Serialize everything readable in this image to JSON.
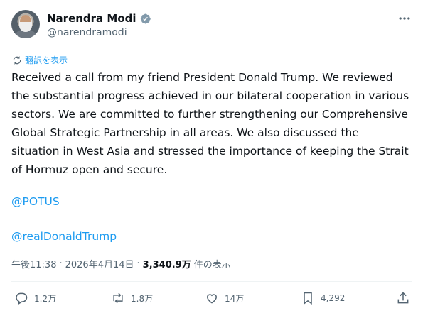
{
  "author": {
    "name": "Narendra Modi",
    "handle": "@narendramodi",
    "verified_color": "#829aab"
  },
  "translate_label": "翻訳を表示",
  "tweet": {
    "text": "Received a call from my friend President Donald Trump. We reviewed the substantial progress achieved in our bilateral cooperation in various sectors. We are committed to further strengthening our Comprehensive Global Strategic Partnership in all areas. We also discussed the situation in West Asia and stressed the importance of keeping the Strait of Hormuz open and secure.",
    "mentions": [
      "@POTUS",
      "@realDonaldTrump"
    ]
  },
  "meta": {
    "time": "午後11:38",
    "separator": "·",
    "date": "2026年4月14日",
    "views": "3,340.9万",
    "views_suffix": "件の表示"
  },
  "actions": {
    "reply": "1.2万",
    "retweet": "1.8万",
    "like": "14万",
    "bookmark": "4,292"
  },
  "colors": {
    "accent": "#1d9bf0",
    "muted": "#536471",
    "text": "#0f1419"
  }
}
